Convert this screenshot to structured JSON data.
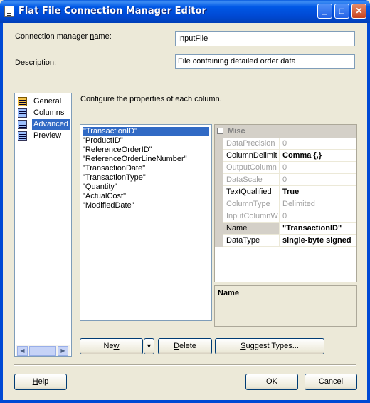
{
  "window": {
    "title": "Flat File Connection Manager Editor",
    "minimize_glyph": "_",
    "maximize_glyph": "□",
    "close_glyph": "✕"
  },
  "form": {
    "name_label_pre": "Connection manager ",
    "name_label_u": "n",
    "name_label_post": "ame:",
    "name_value": "InputFile",
    "desc_label_pre": "D",
    "desc_label_u": "e",
    "desc_label_post": "scription:",
    "desc_value": "File containing detailed order data"
  },
  "pages": [
    {
      "label": "General",
      "icon": "general-icon"
    },
    {
      "label": "Columns",
      "icon": "columns-icon"
    },
    {
      "label": "Advanced",
      "icon": "advanced-icon",
      "selected": true
    },
    {
      "label": "Preview",
      "icon": "preview-icon"
    }
  ],
  "pages_scroll": {
    "left_glyph": "◀",
    "right_glyph": "▶"
  },
  "instruction": "Configure the properties of each column.",
  "columns": [
    "\"TransactionID\"",
    "\"ProductID\"",
    "\"ReferenceOrderID\"",
    "\"ReferenceOrderLineNumber\"",
    "\"TransactionDate\"",
    "\"TransactionType\"",
    "\"Quantity\"",
    "\"ActualCost\"",
    "\"ModifiedDate\""
  ],
  "selected_column_index": 0,
  "grid": {
    "category": "Misc",
    "toggle_glyph": "−",
    "rows": [
      {
        "name": "DataPrecision",
        "value": "0",
        "readonly": true
      },
      {
        "name": "ColumnDelimit",
        "value": "Comma {,}",
        "readonly": false,
        "bold": true
      },
      {
        "name": "OutputColumn",
        "value": "0",
        "readonly": true
      },
      {
        "name": "DataScale",
        "value": "0",
        "readonly": true
      },
      {
        "name": "TextQualified",
        "value": "True",
        "readonly": false,
        "bold": true
      },
      {
        "name": "ColumnType",
        "value": "Delimited",
        "readonly": true
      },
      {
        "name": "InputColumnW",
        "value": "0",
        "readonly": true
      },
      {
        "name": "Name",
        "value": "\"TransactionID\"",
        "readonly": false,
        "bold": true,
        "highlight": true
      },
      {
        "name": "DataType",
        "value": "single-byte signed",
        "readonly": false,
        "bold": true
      }
    ],
    "description_title": "Name"
  },
  "buttons": {
    "new_pre": "Ne",
    "new_u": "w",
    "new_post": "",
    "split_glyph": "▼",
    "delete_pre": "",
    "delete_u": "D",
    "delete_post": "elete",
    "suggest_pre": "",
    "suggest_u": "S",
    "suggest_post": "uggest Types...",
    "help_pre": "",
    "help_u": "H",
    "help_post": "elp",
    "ok": "OK",
    "cancel": "Cancel"
  },
  "colors": {
    "titlebar": "#0058e6",
    "selection": "#316ac5",
    "dialog_bg": "#ece9d8"
  }
}
